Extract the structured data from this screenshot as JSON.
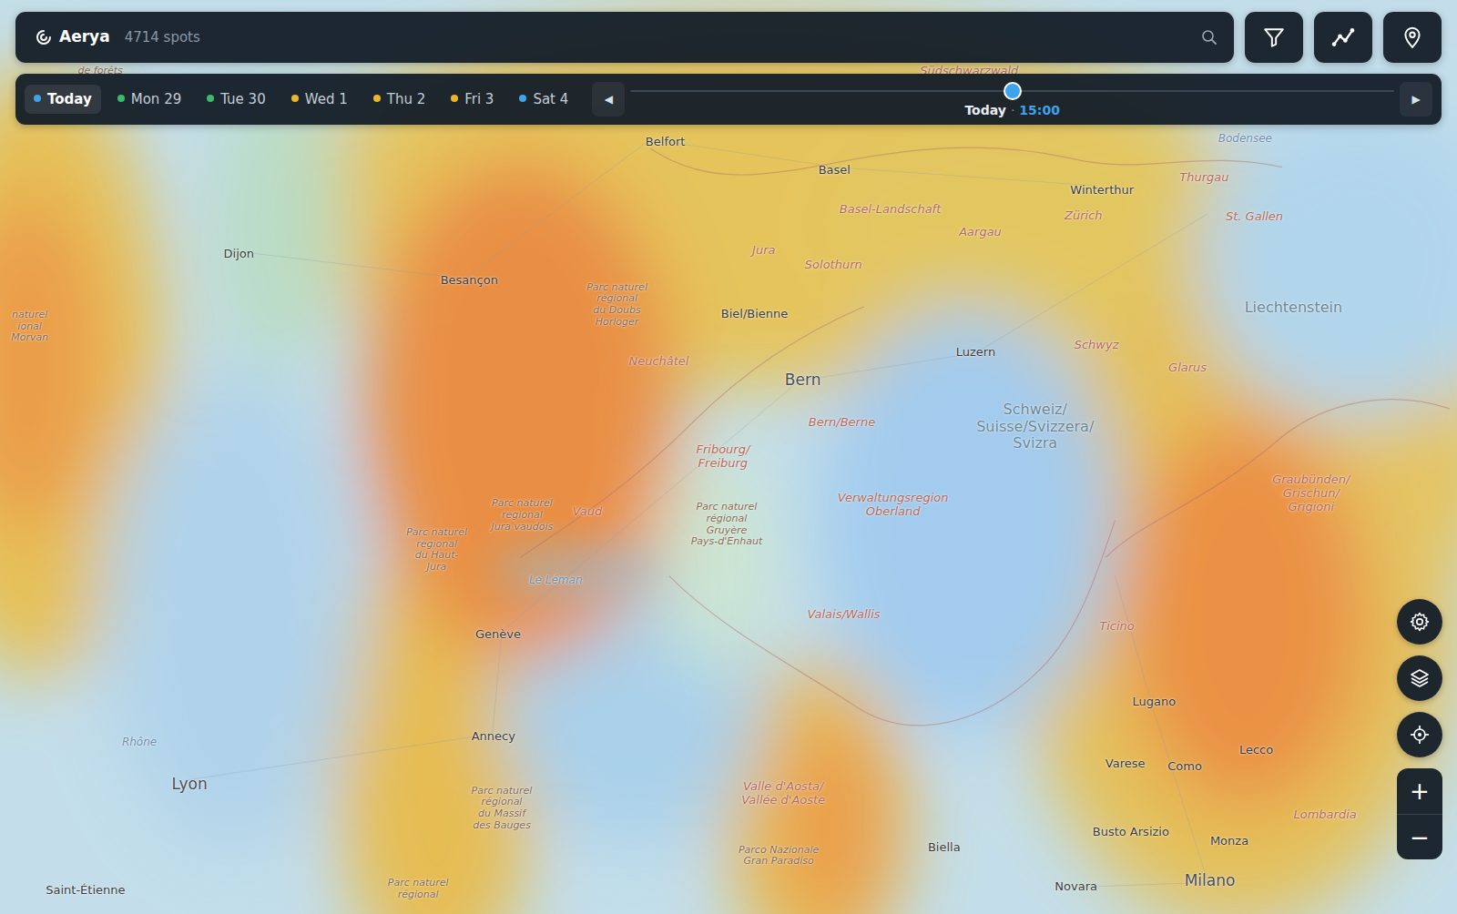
{
  "app": {
    "title": "Aerya",
    "spots": "4714 spots"
  },
  "days": [
    {
      "label": "Today",
      "selected": true,
      "color": "#3ea3ec"
    },
    {
      "label": "Mon 29",
      "selected": false,
      "color": "#3dba6a"
    },
    {
      "label": "Tue 30",
      "selected": false,
      "color": "#3dba6a"
    },
    {
      "label": "Wed 1",
      "selected": false,
      "color": "#e9b62c"
    },
    {
      "label": "Thu 2",
      "selected": false,
      "color": "#e9b62c"
    },
    {
      "label": "Fri 3",
      "selected": false,
      "color": "#e9b62c"
    },
    {
      "label": "Sat 4",
      "selected": false,
      "color": "#3ea3ec"
    }
  ],
  "timeline": {
    "prev": "◀",
    "next": "▶",
    "level": 0.5,
    "day": "Today",
    "separator": "·",
    "time": "15:00"
  },
  "labels": [
    {
      "text": "de forêts",
      "kind": "park"
    },
    {
      "text": "Südschwarzwald",
      "kind": "region"
    },
    {
      "text": "Belfort",
      "kind": "city"
    },
    {
      "text": "Basel",
      "kind": "city"
    },
    {
      "text": "Bodensee",
      "kind": "water"
    },
    {
      "text": "Dijon",
      "kind": "city"
    },
    {
      "text": "Winterthur",
      "kind": "city"
    },
    {
      "text": "Thurgau",
      "kind": "region"
    },
    {
      "text": "Basel-Landschaft",
      "kind": "region"
    },
    {
      "text": "Zürich",
      "kind": "region"
    },
    {
      "text": "Aargau",
      "kind": "region"
    },
    {
      "text": "St. Gallen",
      "kind": "region"
    },
    {
      "text": "Jura",
      "kind": "region"
    },
    {
      "text": "Solothurn",
      "kind": "region"
    },
    {
      "text": "Besançon",
      "kind": "city"
    },
    {
      "text": "Parc naturel\nrégional\ndu Doubs\nHorloger",
      "kind": "park"
    },
    {
      "text": "naturel\nional\nMorvan",
      "kind": "park"
    },
    {
      "text": "Biel/Bienne",
      "kind": "city"
    },
    {
      "text": "Liechtenstein",
      "kind": "country"
    },
    {
      "text": "Neuchâtel",
      "kind": "region"
    },
    {
      "text": "Luzern",
      "kind": "city"
    },
    {
      "text": "Schwyz",
      "kind": "region"
    },
    {
      "text": "Bern",
      "kind": "major"
    },
    {
      "text": "Glarus",
      "kind": "region"
    },
    {
      "text": "Schweiz/\nSuisse/Svizzera/\nSvizra",
      "kind": "country"
    },
    {
      "text": "Bern/Berne",
      "kind": "region"
    },
    {
      "text": "Fribourg/\nFreiburg",
      "kind": "region"
    },
    {
      "text": "Graubünden/\nGrischun/\nGrigioni",
      "kind": "region"
    },
    {
      "text": "Verwaltungsregion\nOberland",
      "kind": "region"
    },
    {
      "text": "Parc naturel\nrégional\nJura vaudois",
      "kind": "park"
    },
    {
      "text": "Vaud",
      "kind": "region"
    },
    {
      "text": "Parc naturel\nrégional\nGruyère\nPays-d'Enhaut",
      "kind": "park"
    },
    {
      "text": "Parc naturel\nrégional\ndu Haut-\nJura",
      "kind": "park"
    },
    {
      "text": "Le Léman",
      "kind": "water"
    },
    {
      "text": "Valais/Wallis",
      "kind": "region"
    },
    {
      "text": "Ticino",
      "kind": "region"
    },
    {
      "text": "Genève",
      "kind": "city"
    },
    {
      "text": "Lugano",
      "kind": "city"
    },
    {
      "text": "Annecy",
      "kind": "city"
    },
    {
      "text": "Rhône",
      "kind": "water"
    },
    {
      "text": "Lecco",
      "kind": "city"
    },
    {
      "text": "Varese",
      "kind": "city"
    },
    {
      "text": "Como",
      "kind": "city"
    },
    {
      "text": "Lyon",
      "kind": "major"
    },
    {
      "text": "Valle d'Aosta/\nVallée d'Aoste",
      "kind": "region"
    },
    {
      "text": "Parc naturel\nrégional\ndu Massif\ndes Bauges",
      "kind": "park"
    },
    {
      "text": "Lombardia",
      "kind": "region"
    },
    {
      "text": "Busto Arsizio",
      "kind": "city"
    },
    {
      "text": "Monza",
      "kind": "city"
    },
    {
      "text": "Biella",
      "kind": "city"
    },
    {
      "text": "Parco Nazionale\nGran Paradiso",
      "kind": "park"
    },
    {
      "text": "Novara",
      "kind": "city"
    },
    {
      "text": "Milano",
      "kind": "major"
    },
    {
      "text": "Saint-Étienne",
      "kind": "city"
    },
    {
      "text": "Parc naturel\nrégional",
      "kind": "park"
    }
  ],
  "controls": {
    "zoom_in": "+",
    "zoom_out": "−"
  }
}
